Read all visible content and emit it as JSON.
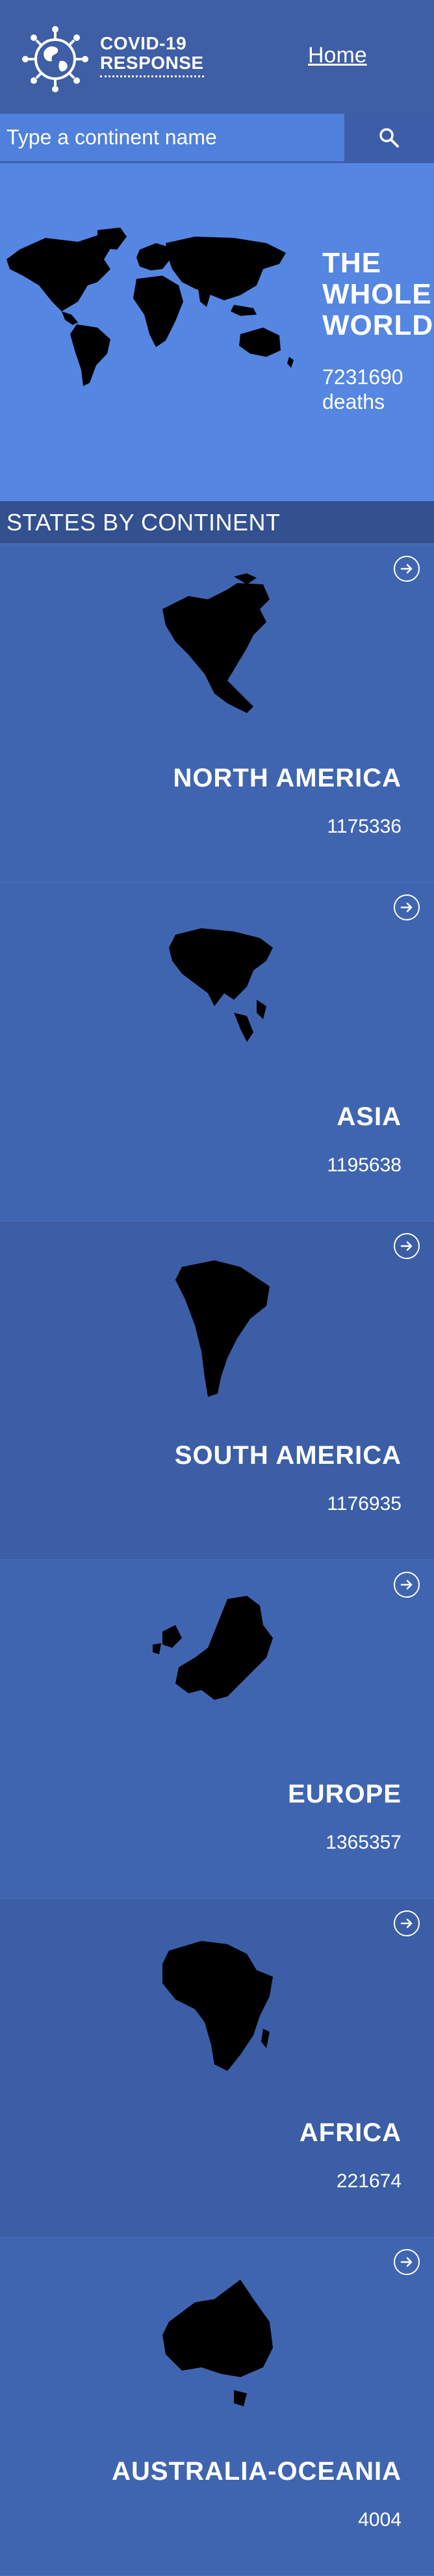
{
  "header": {
    "brand_line1": "COVID-19",
    "brand_line2": "RESPONSE",
    "home_label": "Home",
    "logo_icon": "virus-globe-icon"
  },
  "search": {
    "placeholder": "Type a continent name",
    "value": "",
    "button_icon": "search-icon"
  },
  "world": {
    "title_line1": "THE",
    "title_line2": "WHOLE",
    "title_line3": "WORLD",
    "count": "7231690",
    "count_label": "deaths"
  },
  "section": {
    "title": "STATES BY CONTINENT"
  },
  "continents": [
    {
      "name": "NORTH AMERICA",
      "count": "1175336",
      "icon": "north-america-map-icon"
    },
    {
      "name": "ASIA",
      "count": "1195638",
      "icon": "asia-map-icon"
    },
    {
      "name": "SOUTH AMERICA",
      "count": "1176935",
      "icon": "south-america-map-icon"
    },
    {
      "name": "EUROPE",
      "count": "1365357",
      "icon": "europe-map-icon"
    },
    {
      "name": "AFRICA",
      "count": "221674",
      "icon": "africa-map-icon"
    },
    {
      "name": "AUSTRALIA-OCEANIA",
      "count": "4004",
      "icon": "australia-map-icon"
    }
  ],
  "colors": {
    "header_bg": "#3e5ea5",
    "search_bg": "#4f80dc",
    "world_bg": "#5586e2",
    "section_bg": "#33508f",
    "card_dark": "#3b5ea6",
    "card_light": "#4065b0",
    "text": "#ffffff"
  }
}
